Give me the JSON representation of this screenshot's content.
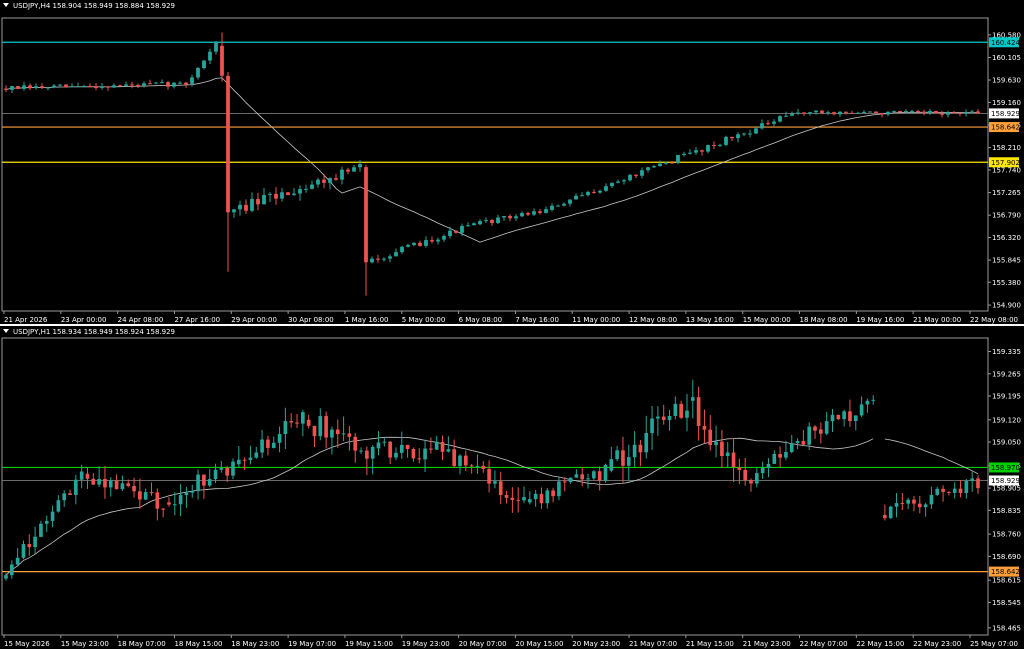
{
  "colors": {
    "bull": "#26A69A",
    "bear": "#EF5350",
    "ma": "#C8C8C8",
    "background": "#000000",
    "text": "#FFFFFF",
    "cyan": "#00C8C8",
    "orange": "#FF9F3A",
    "yellow": "#FFE600",
    "green": "#00D000",
    "current": "#8C8C8C"
  },
  "panes": [
    {
      "title": "USDJPY,H4  158.904 158.949 158.884 158.929",
      "chart_data": {
        "type": "candlestick",
        "symbol": "USDJPY",
        "timeframe": "H4",
        "ohlc_label": [
          158.904,
          158.949,
          158.884,
          158.929
        ],
        "y_ticks": [
          "160.580",
          "160.105",
          "159.630",
          "159.160",
          "158.685",
          "158.210",
          "157.740",
          "157.265",
          "156.790",
          "156.320",
          "155.845",
          "155.380",
          "154.900"
        ],
        "y_tick_values": [
          160.58,
          160.105,
          159.63,
          159.16,
          158.685,
          158.21,
          157.74,
          157.265,
          156.79,
          156.32,
          155.845,
          155.38,
          154.9
        ],
        "ylim": [
          154.86,
          160.85
        ],
        "x_ticks": [
          "21 Apr 2026",
          "23 Apr 00:00",
          "24 Apr 08:00",
          "27 Apr 16:00",
          "29 Apr 00:00",
          "30 Apr 08:00",
          "1 May 16:00",
          "5 May 00:00",
          "6 May 08:00",
          "7 May 16:00",
          "11 May 00:00",
          "12 May 08:00",
          "13 May 16:00",
          "15 May 00:00",
          "18 May 08:00",
          "19 May 16:00",
          "21 May 00:00",
          "22 May 08:00"
        ],
        "levels": [
          {
            "label": "160.424",
            "value": 160.424,
            "color": "cyan"
          },
          {
            "label": "158.642",
            "value": 158.642,
            "color": "orange"
          },
          {
            "label": "157.902",
            "value": 157.902,
            "color": "yellow"
          },
          {
            "label": "158.929",
            "value": 158.929,
            "color": "current"
          }
        ],
        "segments": [
          {
            "bars": 31,
            "from": 159.45,
            "to": 159.55,
            "vol": 0.11
          },
          {
            "bars": 5,
            "from": 159.55,
            "to": 160.4,
            "vol": 0.12
          },
          {
            "bar": {
              "o": 160.35,
              "h": 160.63,
              "l": 159.6,
              "c": 159.72
            }
          },
          {
            "bar": {
              "o": 159.72,
              "h": 159.8,
              "l": 155.6,
              "c": 156.85
            }
          },
          {
            "bars": 22,
            "from": 156.85,
            "to": 157.8,
            "vol": 0.22
          },
          {
            "bar": {
              "o": 157.8,
              "h": 157.85,
              "l": 155.1,
              "c": 155.8
            }
          },
          {
            "bars": 18,
            "from": 155.8,
            "to": 156.6,
            "vol": 0.12
          },
          {
            "bars": 12,
            "from": 156.6,
            "to": 156.9,
            "vol": 0.1
          },
          {
            "bars": 20,
            "from": 156.9,
            "to": 157.9,
            "vol": 0.1
          },
          {
            "bars": 22,
            "from": 157.9,
            "to": 158.95,
            "vol": 0.13
          },
          {
            "bars": 30,
            "from": 158.95,
            "to": 158.929,
            "vol": 0.09
          }
        ],
        "ma_period": 20
      }
    },
    {
      "title": "USDJPY,H1  158.934 158.949 158.924 158.929",
      "chart_data": {
        "type": "candlestick",
        "symbol": "USDJPY",
        "timeframe": "H1",
        "ohlc_label": [
          158.934,
          158.949,
          158.924,
          158.929
        ],
        "y_ticks": [
          "159.335",
          "159.265",
          "159.195",
          "159.120",
          "159.050",
          "158.975",
          "158.905",
          "158.835",
          "158.760",
          "158.690",
          "158.615",
          "158.545",
          "158.465"
        ],
        "y_tick_values": [
          159.335,
          159.265,
          159.195,
          159.12,
          159.05,
          158.975,
          158.905,
          158.835,
          158.76,
          158.69,
          158.615,
          158.545,
          158.465
        ],
        "ylim": [
          158.455,
          159.365
        ],
        "x_ticks": [
          "15 May 2026",
          "15 May 23:00",
          "18 May 07:00",
          "18 May 15:00",
          "18 May 23:00",
          "19 May 07:00",
          "19 May 15:00",
          "19 May 23:00",
          "20 May 07:00",
          "20 May 15:00",
          "20 May 23:00",
          "21 May 07:00",
          "21 May 15:00",
          "21 May 23:00",
          "22 May 07:00",
          "22 May 15:00",
          "22 May 23:00",
          "25 May 07:00"
        ],
        "levels": [
          {
            "label": "158.970",
            "value": 158.97,
            "color": "green"
          },
          {
            "label": "158.929",
            "value": 158.929,
            "color": "current"
          },
          {
            "label": "158.642",
            "value": 158.642,
            "color": "orange"
          }
        ],
        "segments": [
          {
            "bars": 14,
            "from": 158.62,
            "to": 158.95,
            "vol": 0.05
          },
          {
            "bars": 14,
            "from": 158.95,
            "to": 158.86,
            "vol": 0.06
          },
          {
            "bars": 12,
            "from": 158.86,
            "to": 158.98,
            "vol": 0.06
          },
          {
            "bars": 12,
            "from": 158.98,
            "to": 159.12,
            "vol": 0.07
          },
          {
            "bars": 12,
            "from": 159.12,
            "to": 159.03,
            "vol": 0.08
          },
          {
            "bars": 12,
            "from": 159.03,
            "to": 159.02,
            "vol": 0.06
          },
          {
            "bars": 14,
            "from": 159.02,
            "to": 158.86,
            "vol": 0.06
          },
          {
            "bars": 14,
            "from": 158.86,
            "to": 158.96,
            "vol": 0.05
          },
          {
            "bars": 14,
            "from": 158.96,
            "to": 159.18,
            "vol": 0.08
          },
          {
            "bars": 10,
            "from": 159.18,
            "to": 158.93,
            "vol": 0.08
          },
          {
            "bars": 12,
            "from": 158.93,
            "to": 159.09,
            "vol": 0.05
          },
          {
            "bars": 10,
            "from": 159.09,
            "to": 159.18,
            "vol": 0.06
          },
          {
            "gap": 1
          },
          {
            "bars": 17,
            "from": 158.82,
            "to": 158.929,
            "vol": 0.05
          }
        ],
        "ma_period": 24
      }
    }
  ]
}
